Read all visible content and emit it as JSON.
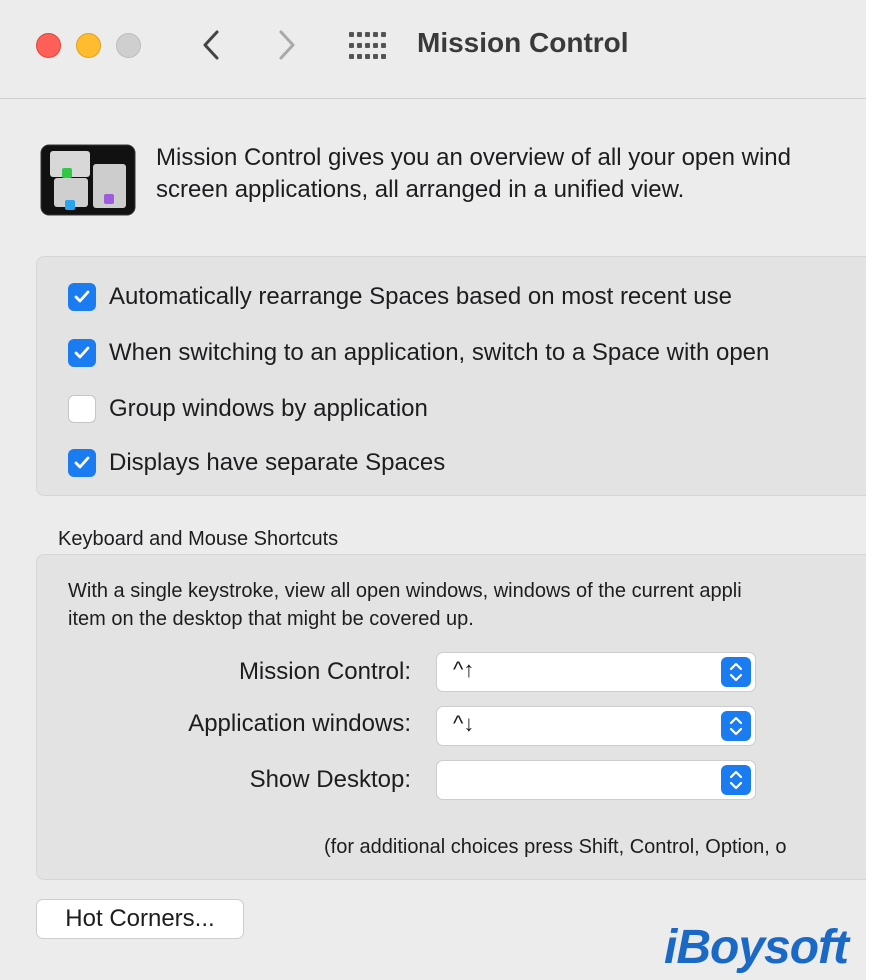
{
  "window": {
    "title": "Mission Control"
  },
  "intro": {
    "line1": "Mission Control gives you an overview of all your open wind",
    "line2": "screen applications, all arranged in a unified view."
  },
  "options": [
    {
      "label": "Automatically rearrange Spaces based on most recent use",
      "checked": true
    },
    {
      "label": "When switching to an application, switch to a Space with open",
      "checked": true
    },
    {
      "label": "Group windows by application",
      "checked": false
    },
    {
      "label": "Displays have separate Spaces",
      "checked": true
    }
  ],
  "shortcuts": {
    "section_label": "Keyboard and Mouse Shortcuts",
    "desc_line1": "With a single keystroke, view all open windows, windows of the current appli",
    "desc_line2": "item on the desktop that might be covered up.",
    "rows": [
      {
        "label": "Mission Control:",
        "value": "^↑"
      },
      {
        "label": "Application windows:",
        "value": "^↓"
      },
      {
        "label": "Show Desktop:",
        "value": ""
      }
    ],
    "footnote": "(for additional choices press Shift, Control, Option, o"
  },
  "hot_corners_label": "Hot Corners...",
  "watermark": "iBoysoft",
  "colors": {
    "accent": "#1a7cf0",
    "close": "#fe5f57",
    "minimize": "#febc2e",
    "zoom_disabled": "#cfcfcf"
  }
}
